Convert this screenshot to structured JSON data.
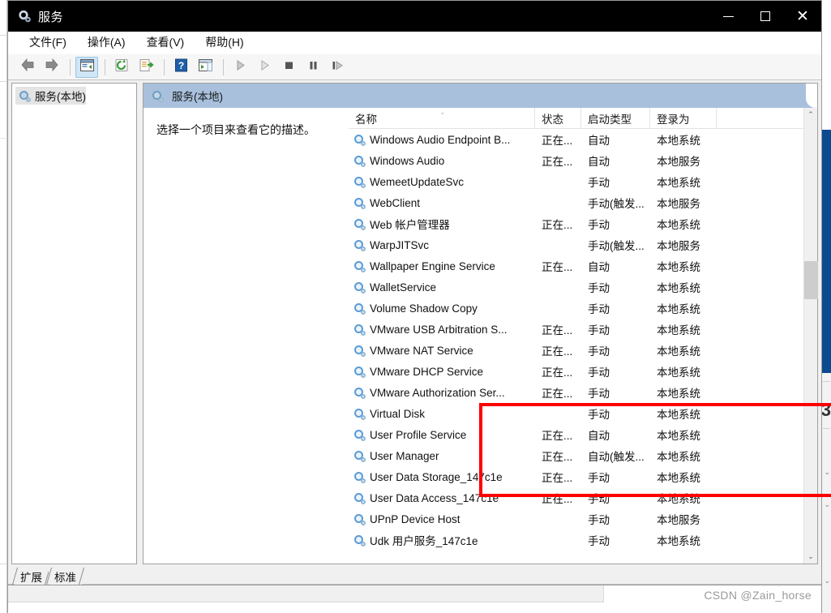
{
  "window": {
    "title": "服务",
    "title_icon": "gear-icon",
    "controls": {
      "minimize": "—",
      "maximize": "□",
      "close": "✕"
    }
  },
  "menubar": {
    "items": [
      {
        "label": "文件(F)",
        "name": "menu-file"
      },
      {
        "label": "操作(A)",
        "name": "menu-action"
      },
      {
        "label": "查看(V)",
        "name": "menu-view"
      },
      {
        "label": "帮助(H)",
        "name": "menu-help"
      }
    ]
  },
  "toolbar": {
    "buttons": [
      {
        "name": "back-button",
        "icon": "arrow-left-icon"
      },
      {
        "name": "forward-button",
        "icon": "arrow-right-icon"
      },
      {
        "name": "show-hide-console-tree-button",
        "icon": "console-tree-icon"
      },
      {
        "name": "refresh-button",
        "icon": "refresh-icon"
      },
      {
        "name": "export-list-button",
        "icon": "export-list-icon"
      },
      {
        "name": "help-button",
        "icon": "question-mark-icon"
      },
      {
        "name": "show-action-pane-button",
        "icon": "action-pane-icon"
      },
      {
        "name": "start-service-button",
        "icon": "play-icon"
      },
      {
        "name": "resume-service-button",
        "icon": "play-outline-icon"
      },
      {
        "name": "stop-service-button",
        "icon": "stop-icon"
      },
      {
        "name": "pause-service-button",
        "icon": "pause-icon"
      },
      {
        "name": "restart-service-button",
        "icon": "restart-icon"
      }
    ]
  },
  "tree": {
    "root_label": "服务(本地)",
    "root_icon": "gear-icon"
  },
  "content": {
    "header_label": "服务(本地)",
    "header_icon": "gear-icon",
    "description": "选择一个项目来查看它的描述。"
  },
  "list": {
    "columns": [
      {
        "key": "name",
        "label": "名称"
      },
      {
        "key": "status",
        "label": "状态"
      },
      {
        "key": "start",
        "label": "启动类型"
      },
      {
        "key": "logon",
        "label": "登录为"
      }
    ],
    "sort_indicator": "⌄",
    "rows": [
      {
        "name": "Windows Audio Endpoint B...",
        "status": "正在...",
        "start": "自动",
        "logon": "本地系统",
        "highlighted": false
      },
      {
        "name": "Windows Audio",
        "status": "正在...",
        "start": "自动",
        "logon": "本地服务",
        "highlighted": false
      },
      {
        "name": "WemeetUpdateSvc",
        "status": "",
        "start": "手动",
        "logon": "本地系统",
        "highlighted": false
      },
      {
        "name": "WebClient",
        "status": "",
        "start": "手动(触发...",
        "logon": "本地服务",
        "highlighted": false
      },
      {
        "name": "Web 帐户管理器",
        "status": "正在...",
        "start": "手动",
        "logon": "本地系统",
        "highlighted": false
      },
      {
        "name": "WarpJITSvc",
        "status": "",
        "start": "手动(触发...",
        "logon": "本地服务",
        "highlighted": false
      },
      {
        "name": "Wallpaper Engine Service",
        "status": "正在...",
        "start": "自动",
        "logon": "本地系统",
        "highlighted": false
      },
      {
        "name": "WalletService",
        "status": "",
        "start": "手动",
        "logon": "本地系统",
        "highlighted": false
      },
      {
        "name": "Volume Shadow Copy",
        "status": "",
        "start": "手动",
        "logon": "本地系统",
        "highlighted": false
      },
      {
        "name": "VMware USB Arbitration S...",
        "status": "正在...",
        "start": "手动",
        "logon": "本地系统",
        "highlighted": true
      },
      {
        "name": "VMware NAT Service",
        "status": "正在...",
        "start": "手动",
        "logon": "本地系统",
        "highlighted": true
      },
      {
        "name": "VMware DHCP Service",
        "status": "正在...",
        "start": "手动",
        "logon": "本地系统",
        "highlighted": true
      },
      {
        "name": "VMware Authorization Ser...",
        "status": "正在...",
        "start": "手动",
        "logon": "本地系统",
        "highlighted": true
      },
      {
        "name": "Virtual Disk",
        "status": "",
        "start": "手动",
        "logon": "本地系统",
        "highlighted": false
      },
      {
        "name": "User Profile Service",
        "status": "正在...",
        "start": "自动",
        "logon": "本地系统",
        "highlighted": false
      },
      {
        "name": "User Manager",
        "status": "正在...",
        "start": "自动(触发...",
        "logon": "本地系统",
        "highlighted": false
      },
      {
        "name": "User Data Storage_147c1e",
        "status": "正在...",
        "start": "手动",
        "logon": "本地系统",
        "highlighted": false
      },
      {
        "name": "User Data Access_147c1e",
        "status": "正在...",
        "start": "手动",
        "logon": "本地系统",
        "highlighted": false
      },
      {
        "name": "UPnP Device Host",
        "status": "",
        "start": "手动",
        "logon": "本地服务",
        "highlighted": false
      },
      {
        "name": "Udk 用户服务_147c1e",
        "status": "",
        "start": "手动",
        "logon": "本地系统",
        "highlighted": false
      }
    ],
    "scrollbar": {
      "up_arrow": "⌃",
      "down_arrow": "⌄"
    }
  },
  "tabs": [
    {
      "label": "扩展",
      "name": "tab-extended",
      "active": false
    },
    {
      "label": "标准",
      "name": "tab-standard",
      "active": true
    }
  ],
  "annotation": {
    "color": "#ff0000",
    "target_rows": [
      "VMware USB Arbitration S...",
      "VMware NAT Service",
      "VMware DHCP Service",
      "VMware Authorization Ser..."
    ]
  },
  "watermark": "CSDN @Zain_horse",
  "background": {
    "partial_number": "3"
  }
}
